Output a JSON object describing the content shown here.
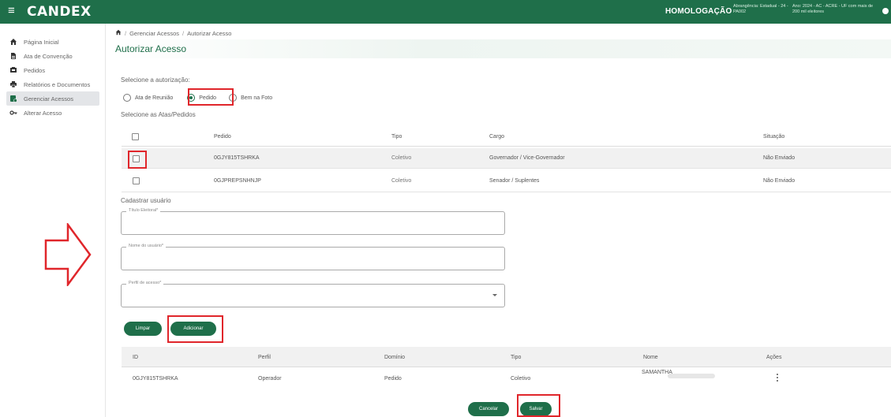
{
  "header": {
    "app_name": "CANDEX",
    "environment": "HOMOLOGAÇÃO",
    "info_left": "Abrangência: Estadual - 24 - PA002",
    "info_right": "Ano: 2024 - AC - ACRE - UF com mais de 200 mil eleitores",
    "colors": {
      "brand": "#1f6f4a",
      "highlight": "#e0262b"
    }
  },
  "sidebar": {
    "items": [
      {
        "label": "Página Inicial",
        "icon": "home-icon"
      },
      {
        "label": "Ata de Convenção",
        "icon": "document-icon"
      },
      {
        "label": "Pedidos",
        "icon": "truck-icon"
      },
      {
        "label": "Relatórios e Documentos",
        "icon": "printer-icon"
      },
      {
        "label": "Gerenciar Acessos",
        "icon": "user-access-icon"
      },
      {
        "label": "Alterar Acesso",
        "icon": "key-icon"
      }
    ]
  },
  "breadcrumb": {
    "items": [
      "Gerenciar Acessos",
      "Autorizar Acesso"
    ]
  },
  "page": {
    "title": "Autorizar Acesso",
    "authorization_label": "Selecione a autorização:",
    "radio_options": [
      "Ata de Reunião",
      "Pedido",
      "Bem na Foto"
    ],
    "selected_radio": "Pedido",
    "select_label": "Selecione as Atas/Pedidos"
  },
  "orders_table": {
    "columns": [
      "Pedido",
      "Tipo",
      "Cargo",
      "Situação"
    ],
    "rows": [
      {
        "pedido": "0GJY815TSHRKA",
        "tipo": "Coletivo",
        "cargo": "Governador / Vice-Governador",
        "situacao": "Não Enviado"
      },
      {
        "pedido": "0GJPREPSNHNJP",
        "tipo": "Coletivo",
        "cargo": "Senador / Suplentes",
        "situacao": "Não Enviado"
      }
    ]
  },
  "user_form": {
    "title": "Cadastrar usuário",
    "field_titulo": "Título Eleitoral*",
    "field_nome": "Nome do usuário*",
    "field_perfil": "Perfil de acesso*",
    "btn_limpar": "Limpar",
    "btn_adicionar": "Adicionar"
  },
  "users_table": {
    "columns": [
      "ID",
      "Perfil",
      "Domínio",
      "Tipo",
      "Nome",
      "Ações"
    ],
    "rows": [
      {
        "id": "0GJY815TSHRKA",
        "perfil": "Operador",
        "dominio": "Pedido",
        "tipo": "Coletivo",
        "nome": "SAMANTHA"
      }
    ]
  },
  "footer": {
    "btn_cancelar": "Cancelar",
    "btn_salvar": "Salvar"
  }
}
